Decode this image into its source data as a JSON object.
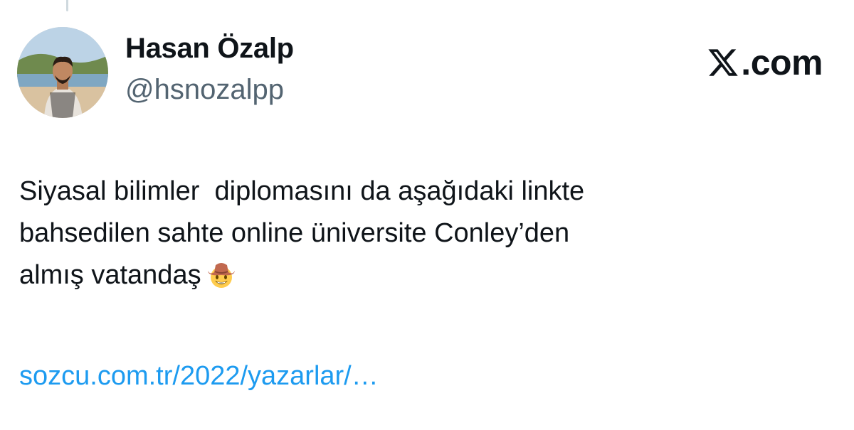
{
  "author": {
    "name": "Hasan Özalp",
    "handle": "@hsnozalpp"
  },
  "brand": {
    "logo_icon": "x-logo-icon",
    "label": ".com"
  },
  "tweet": {
    "text": "Siyasal bilimler  diplomasını da aşağıdaki linkte\nbahsedilen sahte online üniversite Conley’den\nalmış vatandaş",
    "emoji_icon": "cowboy-hat-face-emoji",
    "link": "sozcu.com.tr/2022/yazarlar/…"
  },
  "colors": {
    "text": "#0f1419",
    "secondary": "#536471",
    "link": "#1d9bf0"
  }
}
